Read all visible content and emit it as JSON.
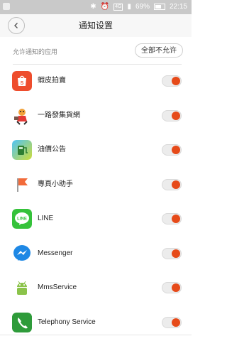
{
  "status_bar": {
    "bluetooth_icon": "bluetooth-icon",
    "network_label": "4G",
    "battery": "69%",
    "time": "22:15"
  },
  "header": {
    "back_icon": "chevron-left-icon",
    "title": "通知设置"
  },
  "section": {
    "label": "允许通知的应用",
    "disallow_all": "全部不允许"
  },
  "apps": [
    {
      "name": "蝦皮拍賣",
      "icon": "shopee-icon",
      "color": "#ee4d2d",
      "enabled": true
    },
    {
      "name": "一路發集貨網",
      "icon": "mascot-icon",
      "color": "#f2a23a",
      "enabled": true
    },
    {
      "name": "油價公告",
      "icon": "gas-pump-icon",
      "color": "#8bc34a",
      "enabled": true
    },
    {
      "name": "專頁小助手",
      "icon": "flag-icon",
      "color": "#f26b3a",
      "enabled": true
    },
    {
      "name": "LINE",
      "icon": "line-icon",
      "color": "#35c23a",
      "enabled": true
    },
    {
      "name": "Messenger",
      "icon": "messenger-icon",
      "color": "#1e88e5",
      "enabled": true
    },
    {
      "name": "MmsService",
      "icon": "android-icon",
      "color": "#8bc34a",
      "enabled": true
    },
    {
      "name": "Telephony Service",
      "icon": "phone-icon",
      "color": "#2e9b3a",
      "enabled": true
    }
  ],
  "colors": {
    "toggle_on": "#e64a19",
    "header_bg": "#f7f7f7",
    "status_bg": "#c9c9c9"
  }
}
